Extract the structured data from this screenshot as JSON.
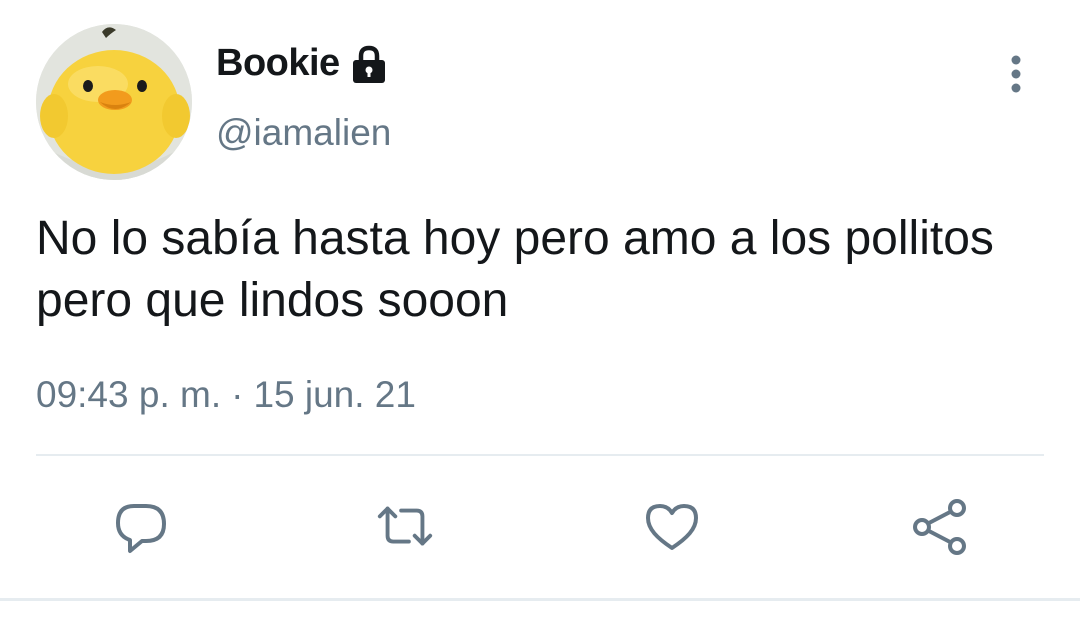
{
  "user": {
    "display_name": "Bookie",
    "handle": "@iamalien",
    "protected_icon": "lock-icon",
    "avatar": "yellow-chick-plush"
  },
  "tweet": {
    "text": "No lo sabía hasta hoy pero amo a los pollitos pero que lindos sooon",
    "time": "09:43 p. m.",
    "separator": "·",
    "date": "15 jun. 21"
  },
  "actions": [
    {
      "name": "reply",
      "icon": "reply-icon"
    },
    {
      "name": "retweet",
      "icon": "retweet-icon"
    },
    {
      "name": "like",
      "icon": "heart-icon"
    },
    {
      "name": "share",
      "icon": "share-icon"
    }
  ],
  "menu_icon": "more-vertical-icon",
  "colors": {
    "text": "#14171a",
    "secondary": "#657786",
    "divider": "#e6ecf0",
    "avatar_chick": "#f7d23e"
  }
}
